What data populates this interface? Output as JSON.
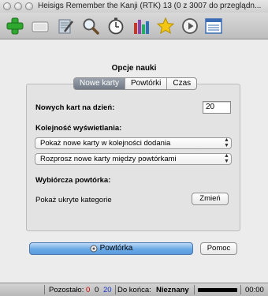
{
  "window": {
    "title": "Heisigs Remember the Kanji (RTK) 13 (0 z 3007 do przeglądn..."
  },
  "toolbar": {
    "buttons": [
      {
        "name": "add",
        "icon": "green-plus-icon"
      },
      {
        "name": "deck",
        "icon": "card-icon"
      },
      {
        "name": "edit",
        "icon": "notepad-pencil-icon"
      },
      {
        "name": "browse",
        "icon": "magnifier-icon"
      },
      {
        "name": "timer",
        "icon": "stopwatch-icon"
      },
      {
        "name": "stats",
        "icon": "bar-chart-icon"
      },
      {
        "name": "mark",
        "icon": "star-icon"
      },
      {
        "name": "play",
        "icon": "play-icon"
      },
      {
        "name": "list",
        "icon": "window-list-icon"
      }
    ]
  },
  "dialog": {
    "title": "Opcje nauki",
    "tabs": [
      "Nowe karty",
      "Powtórki",
      "Czas"
    ],
    "active_tab": "Nowe karty",
    "new_cards_per_day_label": "Nowych kart na dzień:",
    "new_cards_per_day_value": "20",
    "display_order_label": "Kolejność wyświetlania:",
    "order_select_1": "Pokaż nowe karty w kolejności dodania",
    "order_select_2": "Rozprosz nowe karty między powtórkami",
    "selective_review_label": "Wybiórcza powtórka:",
    "hidden_categories_label": "Pokaż ukryte kategorie",
    "change_button": "Zmień",
    "review_button": "Powtórka",
    "help_button": "Pomoc"
  },
  "statusbar": {
    "remaining_label": "Pozostało:",
    "count_red": "0",
    "count_black": "0",
    "count_blue": "20",
    "until_end_label": "Do końca:",
    "until_end_value": "Nieznany",
    "progress_fraction": 1.0,
    "time": "00:00"
  },
  "colors": {
    "red": "#d40000",
    "blue": "#1a35c8",
    "primary_button": "#6aa9e6"
  }
}
